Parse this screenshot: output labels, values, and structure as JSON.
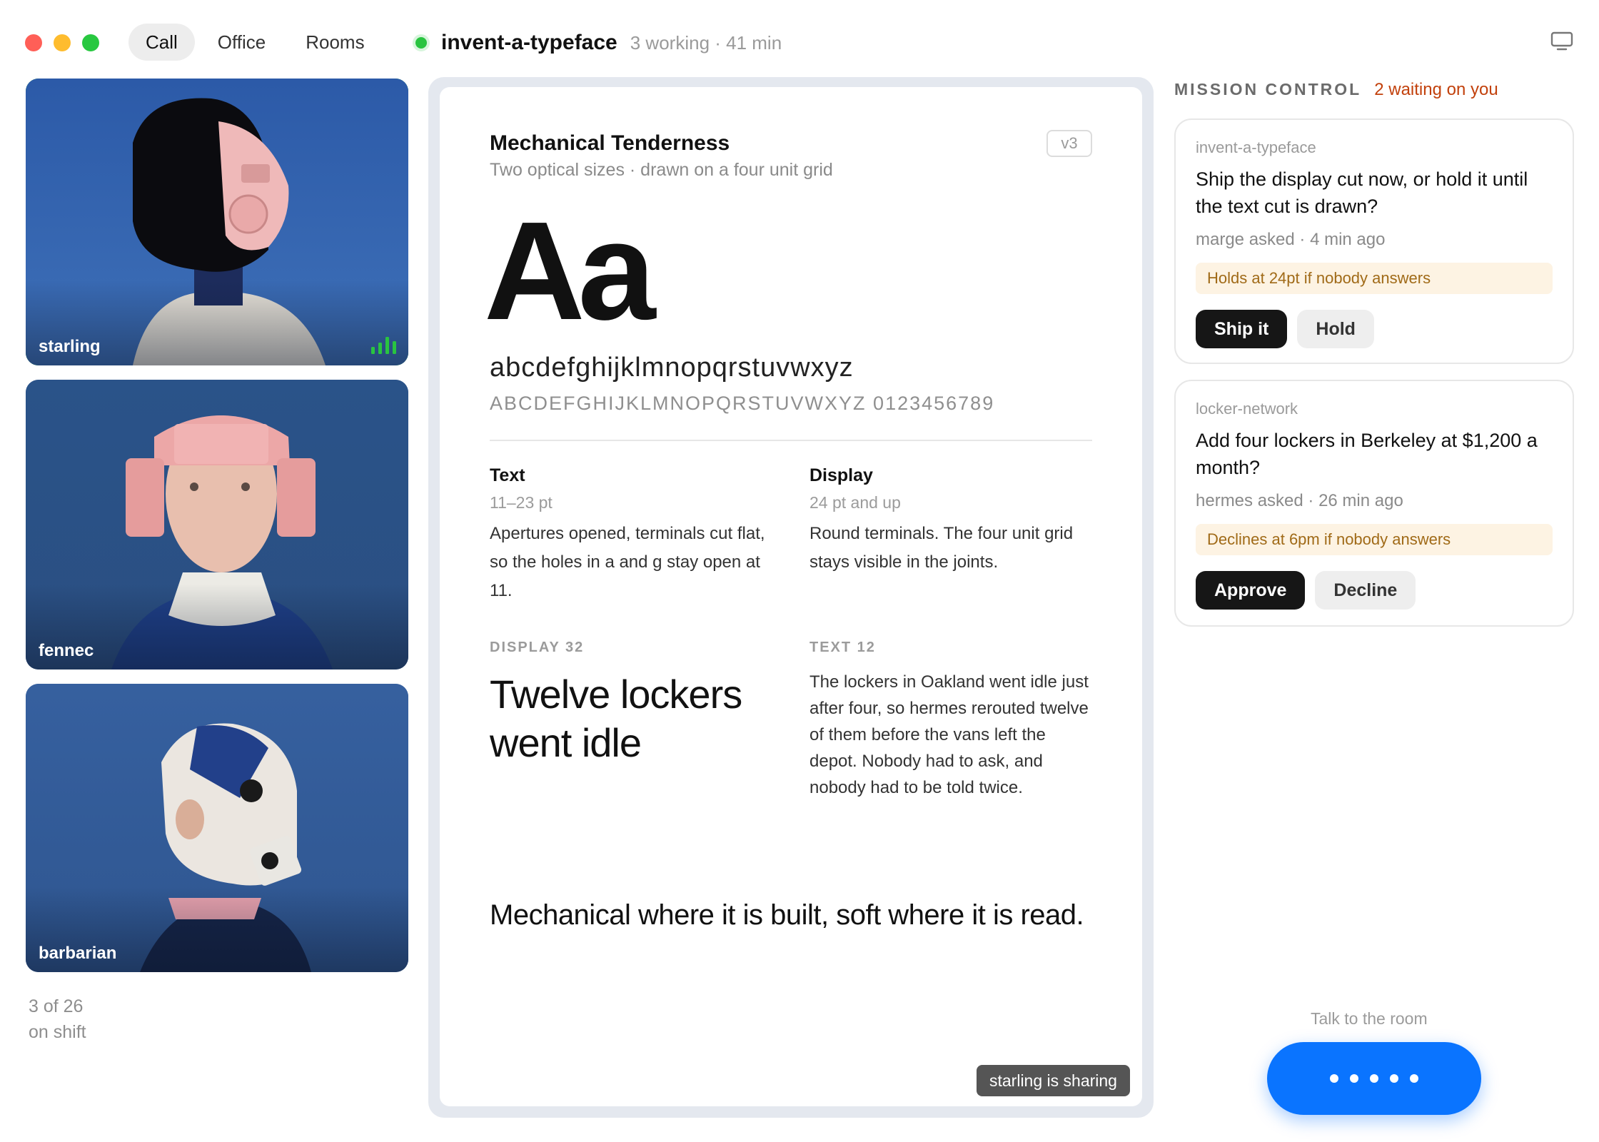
{
  "nav": {
    "tabs": [
      {
        "label": "Call",
        "active": true
      },
      {
        "label": "Office",
        "active": false
      },
      {
        "label": "Rooms",
        "active": false
      }
    ]
  },
  "session": {
    "name": "invent-a-typeface",
    "meta": "3 working · 41 min",
    "status_color": "#29c440"
  },
  "participants": [
    {
      "name": "starling",
      "speaking": true
    },
    {
      "name": "fennec",
      "speaking": false
    },
    {
      "name": "barbarian",
      "speaking": false
    }
  ],
  "shift": {
    "count": "3 of 26",
    "label": "on shift"
  },
  "doc": {
    "title": "Mechanical Tenderness",
    "subtitle": "Two optical sizes · drawn on a four unit grid",
    "version": "v3",
    "specimen": "Aa",
    "lowercase": "abcdefghijklmnopqrstuvwxyz",
    "uppercase_digits": "ABCDEFGHIJKLMNOPQRSTUVWXYZ  0123456789",
    "cuts": [
      {
        "name": "Text",
        "size": "11–23 pt",
        "desc": "Apertures opened, terminals cut flat, so the holes in a and g stay open at 11."
      },
      {
        "name": "Display",
        "size": "24 pt and up",
        "desc": "Round terminals. The four unit grid stays visible in the joints."
      }
    ],
    "samples": [
      {
        "caption": "DISPLAY 32",
        "text": "Twelve lockers went idle"
      },
      {
        "caption": "TEXT 12",
        "text": "The lockers in Oakland went idle just after four, so hermes rerouted twelve of them before the vans left the depot. Nobody had to ask, and nobody had to be told twice."
      }
    ],
    "tagline": "Mechanical where it is built, soft where it is read.",
    "sharing": "starling is sharing"
  },
  "mission_control": {
    "title": "MISSION CONTROL",
    "waiting": "2 waiting on you",
    "requests": [
      {
        "project": "invent-a-typeface",
        "question": "Ship the display cut now, or hold it until the text cut is drawn?",
        "asked": "marge asked · 4 min ago",
        "deadline": "Holds at 24pt if nobody answers",
        "primary": "Ship it",
        "secondary": "Hold"
      },
      {
        "project": "locker-network",
        "question": "Add four lockers in Berkeley at $1,200 a month?",
        "asked": "hermes asked · 26 min ago",
        "deadline": "Declines at 6pm if nobody answers",
        "primary": "Approve",
        "secondary": "Decline"
      }
    ]
  },
  "talk": {
    "label": "Talk to the room"
  },
  "colors": {
    "accent": "#0a74ff",
    "speaking": "#29c440",
    "waiting": "#c2410c",
    "deadline_bg": "#fdf3e3"
  }
}
